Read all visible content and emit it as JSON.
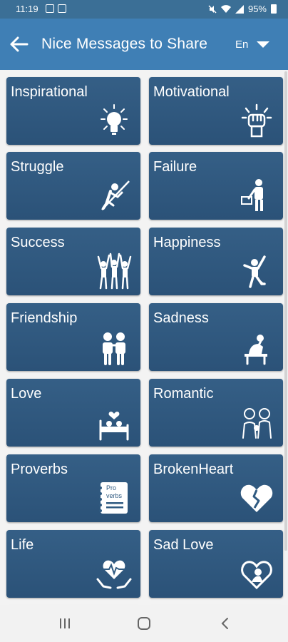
{
  "status": {
    "time": "11:19",
    "battery": "95%"
  },
  "header": {
    "title": "Nice Messages to Share",
    "language": "En"
  },
  "categories": [
    {
      "label": "Inspirational",
      "icon": "lightbulb-icon"
    },
    {
      "label": "Motivational",
      "icon": "fist-icon"
    },
    {
      "label": "Struggle",
      "icon": "climbing-icon"
    },
    {
      "label": "Failure",
      "icon": "failure-person-icon"
    },
    {
      "label": "Success",
      "icon": "celebrating-group-icon"
    },
    {
      "label": "Happiness",
      "icon": "jumping-person-icon"
    },
    {
      "label": "Friendship",
      "icon": "friends-icon"
    },
    {
      "label": "Sadness",
      "icon": "sad-person-icon"
    },
    {
      "label": "Love",
      "icon": "couple-bed-icon"
    },
    {
      "label": "Romantic",
      "icon": "romantic-couple-icon"
    },
    {
      "label": "Proverbs",
      "icon": "proverbs-notebook-icon",
      "icon_text": [
        "Pro",
        "verbs"
      ]
    },
    {
      "label": "BrokenHeart",
      "icon": "broken-heart-icon"
    },
    {
      "label": "Life",
      "icon": "heart-hands-icon"
    },
    {
      "label": "Sad Love",
      "icon": "sad-heart-icon"
    }
  ],
  "colors": {
    "appbar": "#3f7fb5",
    "statusbar": "#3b6f96",
    "card": "#2f5a81",
    "background": "#f3f3f3"
  }
}
